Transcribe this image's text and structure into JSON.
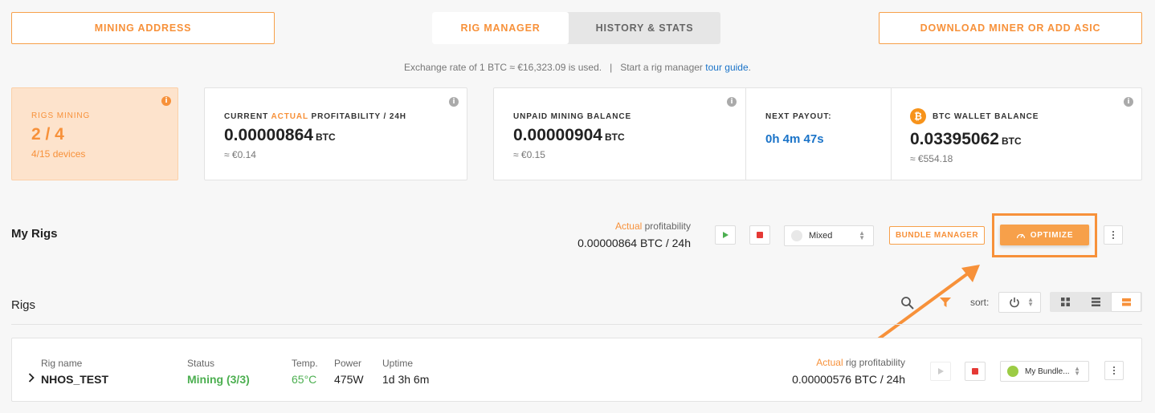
{
  "header": {
    "mining_address": "MINING ADDRESS",
    "tabs": [
      {
        "label": "RIG MANAGER",
        "active": true
      },
      {
        "label": "HISTORY & STATS",
        "active": false
      }
    ],
    "download": "DOWNLOAD MINER OR ADD ASIC"
  },
  "rate_line": {
    "rate": "Exchange rate of 1 BTC ≈ €16,323.09 is used.",
    "separator": "|",
    "tour_prefix": "Start a rig manager",
    "tour_link": "tour guide",
    "tour_suffix": "."
  },
  "rigs_mining": {
    "label": "RIGS MINING",
    "value": "2 / 4",
    "devices": "4/15 devices"
  },
  "profitability": {
    "label_pre": "CURRENT ",
    "label_hl": "ACTUAL",
    "label_post": " PROFITABILITY / 24H",
    "value": "0.00000864",
    "unit": "BTC",
    "fiat": "≈ €0.14"
  },
  "unpaid": {
    "label": "UNPAID MINING BALANCE",
    "value": "0.00000904",
    "unit": "BTC",
    "fiat": "≈ €0.15"
  },
  "payout": {
    "label": "NEXT PAYOUT:",
    "value": "0h 4m 47s"
  },
  "wallet": {
    "label": "BTC WALLET BALANCE",
    "value": "0.03395062",
    "unit": "BTC",
    "fiat": "≈ €554.18"
  },
  "my_rigs": {
    "title": "My Rigs",
    "actual": "Actual",
    "profit_label": " profitability",
    "profit_value": "0.00000864 BTC / 24h",
    "mode": "Mixed",
    "bundle_manager": "BUNDLE MANAGER",
    "optimize": "OPTIMIZE"
  },
  "rigs": {
    "title": "Rigs",
    "sort_label": "sort:"
  },
  "rig_row": {
    "name_label": "Rig name",
    "name": "NHOS_TEST",
    "status_label": "Status",
    "status": "Mining (3/3)",
    "temp_label": "Temp.",
    "temp": "65°C",
    "power_label": "Power",
    "power": "475W",
    "uptime_label": "Uptime",
    "uptime": "1d 3h 6m",
    "actual": "Actual",
    "profit_label": " rig profitability",
    "profit_value": "0.00000576 BTC / 24h",
    "bundle": "My Bundle..."
  },
  "colors": {
    "accent": "#f7913a",
    "green": "#4caf50",
    "blue": "#1a73c8",
    "stop": "#e53935"
  }
}
